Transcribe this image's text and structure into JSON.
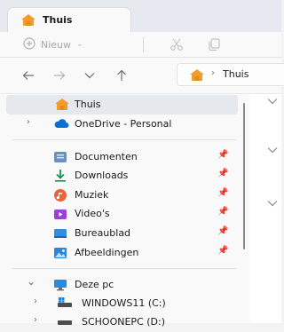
{
  "tab": {
    "title": "Thuis"
  },
  "toolbar": {
    "new_label": "Nieuw"
  },
  "address": {
    "separator": "›",
    "current": "Thuis"
  },
  "sidebar": {
    "top": [
      {
        "label": "Thuis",
        "selected": true
      },
      {
        "label": "OneDrive - Personal",
        "expand": "›"
      }
    ],
    "quick_access": [
      {
        "label": "Documenten",
        "icon": "documents-icon"
      },
      {
        "label": "Downloads",
        "icon": "downloads-icon"
      },
      {
        "label": "Muziek",
        "icon": "music-icon"
      },
      {
        "label": "Video's",
        "icon": "videos-icon"
      },
      {
        "label": "Bureaublad",
        "icon": "desktop-icon"
      },
      {
        "label": "Afbeeldingen",
        "icon": "pictures-icon"
      }
    ],
    "this_pc": {
      "label": "Deze pc",
      "expand": "⌄"
    },
    "drives": [
      {
        "label": "WINDOWS11 (C:)",
        "expand": "›"
      },
      {
        "label": "SCHOONEPC (D:)",
        "expand": "›"
      }
    ]
  },
  "colors": {
    "accent": "#0b6ed1",
    "home": "#f29b2e",
    "selected_bg": "#e5e8ed"
  }
}
